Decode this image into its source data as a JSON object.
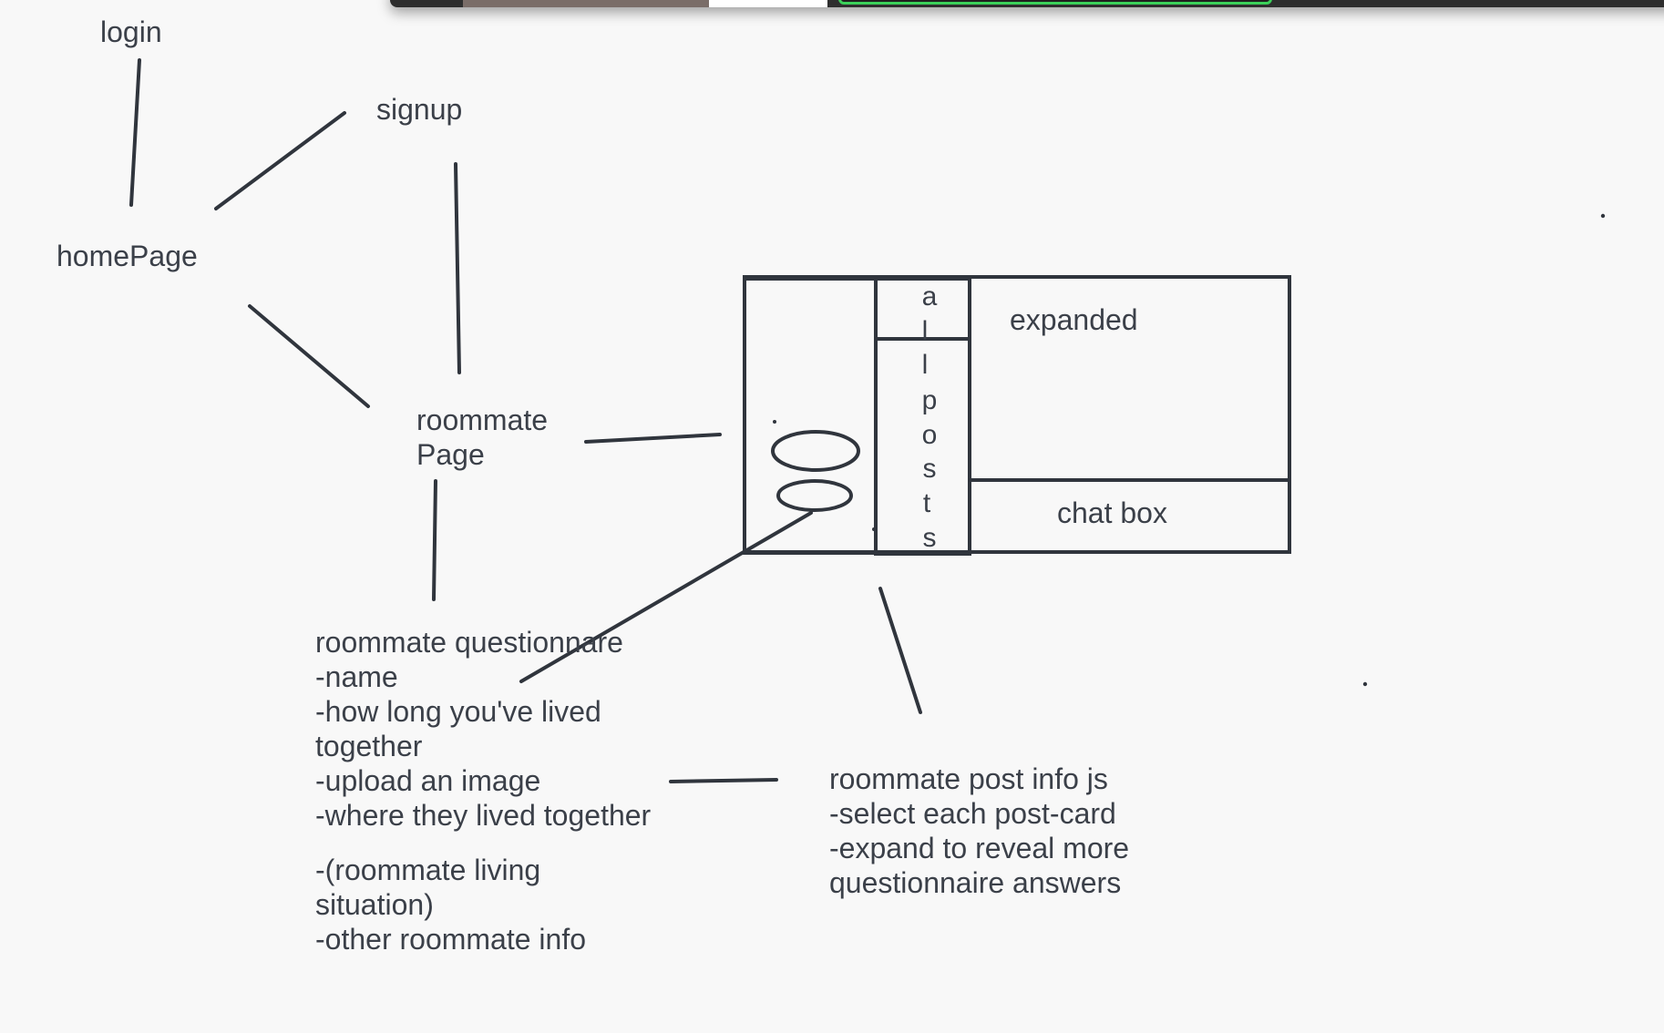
{
  "nodes": {
    "login": "login",
    "signup": "signup",
    "home_page": "homePage",
    "roommate_page": [
      "roommate",
      "Page"
    ],
    "expanded": "expanded",
    "chat_box": "chat box",
    "all_posts_letters": [
      "a",
      "l",
      "l",
      "p",
      "o",
      "s",
      "t",
      "s"
    ]
  },
  "questionnaire": {
    "lines": [
      "roommate questionnare",
      "-name",
      "-how long you've lived",
      "together",
      "-upload an image",
      "-where they lived together"
    ],
    "extra_lines": [
      "-(roommate living",
      "situation)",
      "-other roommate info"
    ]
  },
  "post_info": {
    "lines": [
      "roommate post info js",
      "-select each post-card",
      "-expand to reveal more",
      "questionnaire answers"
    ]
  },
  "colors": {
    "ink": "#3b4049",
    "background": "#f8f8f8",
    "accent_tab": "#3bd05a"
  }
}
